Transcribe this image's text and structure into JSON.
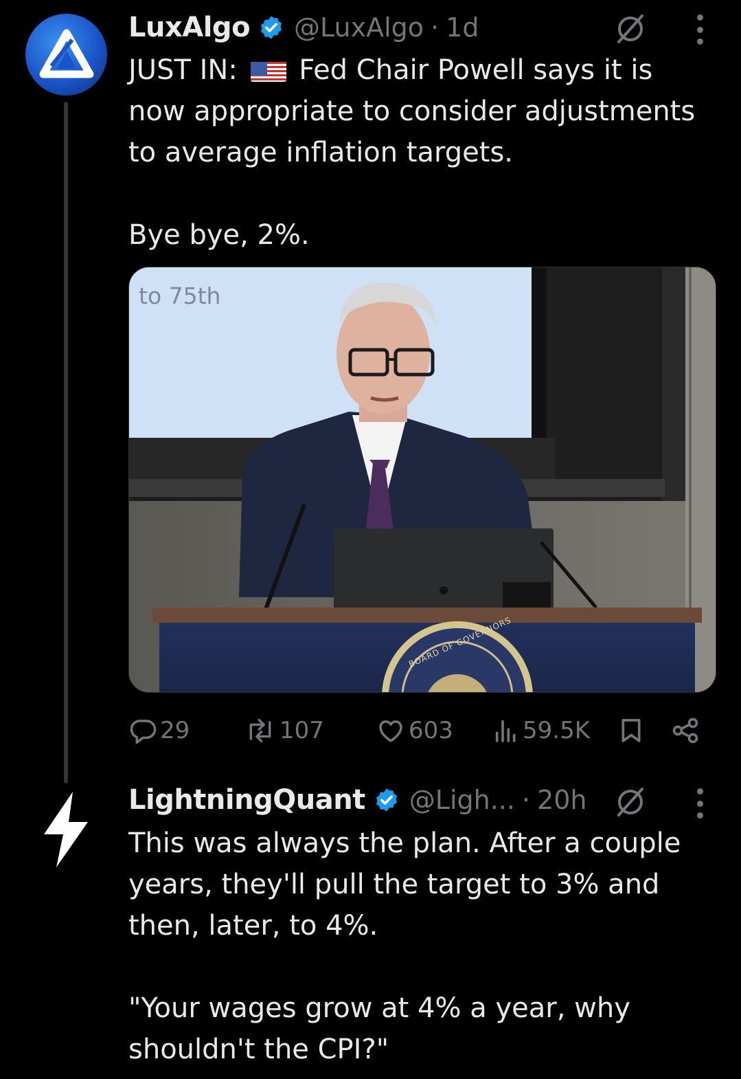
{
  "tweets": [
    {
      "display_name": "LuxAlgo",
      "handle": "@LuxAlgo",
      "separator": "·",
      "time": "1d",
      "text_prefix": "JUST IN: ",
      "text_flag": "us-flag-emoji",
      "text_line1_rest": " Fed Chair Powell says it is",
      "text_rest": "now appropriate to consider adjustments\nto average inflation targets.\n\nBye bye, 2%.",
      "media": {
        "slide_text": "to 75th",
        "seal_text": "BOARD OF GOVERNORS"
      },
      "actions": {
        "replies": "29",
        "reposts": "107",
        "likes": "603",
        "views": "59.5K"
      }
    },
    {
      "display_name": "LightningQuant",
      "handle": "@Ligh...",
      "separator": "·",
      "time": "20h",
      "text": "This was always the plan. After a couple\nyears, they'll pull the target to 3% and\nthen, later, to 4%.\n\n\"Your wages grow at 4% a year, why\nshouldn't the CPI?\""
    }
  ],
  "icons": {
    "verified": "verified-badge-icon",
    "grok": "grok-icon",
    "more": "more-options-icon",
    "reply": "reply-icon",
    "repost": "repost-icon",
    "like": "like-icon",
    "views": "views-icon",
    "bookmark": "bookmark-icon",
    "share": "share-icon"
  },
  "colors": {
    "background": "#000000",
    "primary_text": "#e7e9ea",
    "secondary_text": "#71767b",
    "verified_blue": "#1d9bf0",
    "thread_line": "#333639"
  }
}
